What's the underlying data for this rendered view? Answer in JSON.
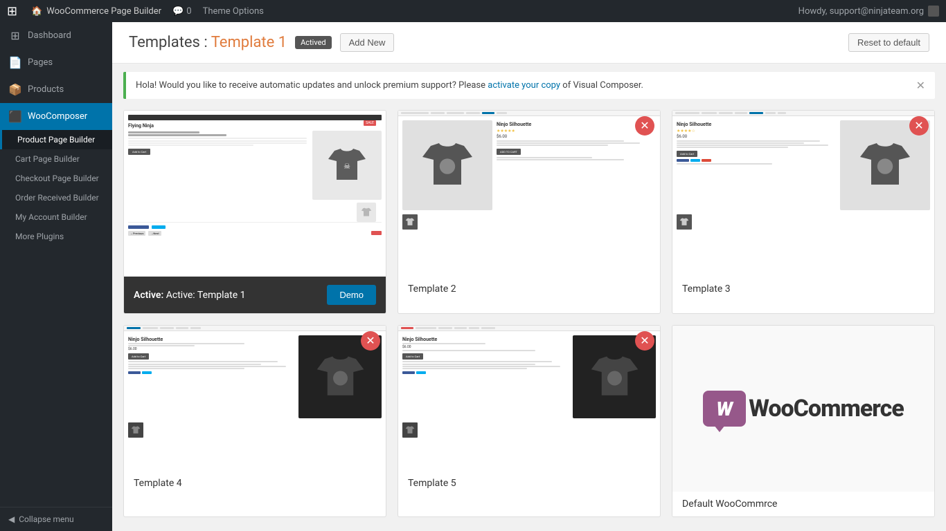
{
  "adminBar": {
    "wpLogo": "⊞",
    "siteName": "WooCommerce Page Builder",
    "commentsIcon": "💬",
    "commentsCount": "0",
    "themeOptions": "Theme Options",
    "howdy": "Howdy, support@ninjateam.org"
  },
  "sidebar": {
    "items": [
      {
        "id": "dashboard",
        "label": "Dashboard",
        "icon": "⊞"
      },
      {
        "id": "pages",
        "label": "Pages",
        "icon": "📄"
      },
      {
        "id": "products",
        "label": "Products",
        "icon": "📦"
      },
      {
        "id": "woocomposer",
        "label": "WooComposer",
        "icon": "⬛",
        "active": true
      }
    ],
    "subItems": [
      {
        "id": "product-page-builder",
        "label": "Product Page Builder",
        "active": true
      },
      {
        "id": "cart-page-builder",
        "label": "Cart Page Builder"
      },
      {
        "id": "checkout-page-builder",
        "label": "Checkout Page Builder"
      },
      {
        "id": "order-received-builder",
        "label": "Order Received Builder"
      },
      {
        "id": "my-account-builder",
        "label": "My Account Builder"
      },
      {
        "id": "more-plugins",
        "label": "More Plugins"
      }
    ],
    "collapseLabel": "Collapse menu"
  },
  "page": {
    "titlePrefix": "Templates : ",
    "titleHighlight": "Template 1",
    "activeBadge": "Actived",
    "addNewLabel": "Add New",
    "resetDefaultLabel": "Reset to default"
  },
  "notice": {
    "text": "Hola! Would you like to receive automatic updates and unlock premium support? Please ",
    "linkText": "activate your copy",
    "textSuffix": " of Visual Composer."
  },
  "templates": [
    {
      "id": "template-1",
      "label": "Active: Template 1",
      "isActive": true,
      "demoLabel": "Demo",
      "hasRemove": false
    },
    {
      "id": "template-2",
      "label": "Template 2",
      "isActive": false,
      "hasRemove": true
    },
    {
      "id": "template-3",
      "label": "Template 3",
      "isActive": false,
      "hasRemove": true
    },
    {
      "id": "template-4",
      "label": "Template 4",
      "isActive": false,
      "hasRemove": true
    },
    {
      "id": "template-5",
      "label": "Template 5",
      "isActive": false,
      "hasRemove": true
    },
    {
      "id": "default-woocommerce",
      "label": "Default WooCommrce",
      "isActive": false,
      "hasRemove": false,
      "isWooDefault": true
    }
  ],
  "colors": {
    "accent": "#0073aa",
    "danger": "#e05252",
    "activeBar": "#333",
    "demoBtnBg": "#0073aa"
  }
}
